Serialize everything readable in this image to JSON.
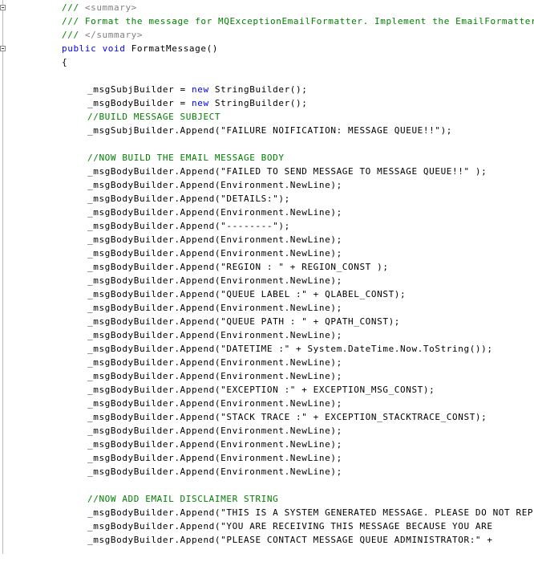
{
  "editor": {
    "lines": [
      {
        "indent": 1,
        "parts": [
          {
            "t": "/// ",
            "c": "cmt"
          },
          {
            "t": "<summary>",
            "c": "doc"
          }
        ]
      },
      {
        "indent": 1,
        "parts": [
          {
            "t": "/// Format the message for MQExceptionEmailFormatter. Implement the EmailFormatter",
            "c": "cmt"
          }
        ]
      },
      {
        "indent": 1,
        "parts": [
          {
            "t": "/// ",
            "c": "cmt"
          },
          {
            "t": "</summary>",
            "c": "doc"
          }
        ]
      },
      {
        "indent": 1,
        "parts": [
          {
            "t": "public",
            "c": "kw"
          },
          {
            "t": " ",
            "c": "plain"
          },
          {
            "t": "void",
            "c": "kw"
          },
          {
            "t": " FormatMessage()",
            "c": "plain"
          }
        ]
      },
      {
        "indent": 1,
        "parts": [
          {
            "t": "{",
            "c": "plain"
          }
        ]
      },
      {
        "indent": 2,
        "parts": []
      },
      {
        "indent": 2,
        "parts": [
          {
            "t": "_msgSubjBuilder = ",
            "c": "plain"
          },
          {
            "t": "new",
            "c": "kw"
          },
          {
            "t": " StringBuilder();",
            "c": "plain"
          }
        ]
      },
      {
        "indent": 2,
        "parts": [
          {
            "t": "_msgBodyBuilder = ",
            "c": "plain"
          },
          {
            "t": "new",
            "c": "kw"
          },
          {
            "t": " StringBuilder();",
            "c": "plain"
          }
        ]
      },
      {
        "indent": 2,
        "parts": [
          {
            "t": "//BUILD MESSAGE SUBJECT",
            "c": "cmt"
          }
        ]
      },
      {
        "indent": 2,
        "parts": [
          {
            "t": "_msgSubjBuilder.Append(\"FAILURE NOIFICATION: MESSAGE QUEUE!!\");",
            "c": "plain"
          }
        ]
      },
      {
        "indent": 2,
        "parts": []
      },
      {
        "indent": 2,
        "parts": [
          {
            "t": "//NOW BUILD THE EMAIL MESSAGE BODY",
            "c": "cmt"
          }
        ]
      },
      {
        "indent": 2,
        "parts": [
          {
            "t": "_msgBodyBuilder.Append(\"FAILED TO SEND MESSAGE TO MESSAGE QUEUE!!\" );",
            "c": "plain"
          }
        ]
      },
      {
        "indent": 2,
        "parts": [
          {
            "t": "_msgBodyBuilder.Append(Environment.NewLine);",
            "c": "plain"
          }
        ]
      },
      {
        "indent": 2,
        "parts": [
          {
            "t": "_msgBodyBuilder.Append(\"DETAILS:\");",
            "c": "plain"
          }
        ]
      },
      {
        "indent": 2,
        "parts": [
          {
            "t": "_msgBodyBuilder.Append(Environment.NewLine);",
            "c": "plain"
          }
        ]
      },
      {
        "indent": 2,
        "parts": [
          {
            "t": "_msgBodyBuilder.Append(\"--------\");",
            "c": "plain"
          }
        ]
      },
      {
        "indent": 2,
        "parts": [
          {
            "t": "_msgBodyBuilder.Append(Environment.NewLine);",
            "c": "plain"
          }
        ]
      },
      {
        "indent": 2,
        "parts": [
          {
            "t": "_msgBodyBuilder.Append(Environment.NewLine);",
            "c": "plain"
          }
        ]
      },
      {
        "indent": 2,
        "parts": [
          {
            "t": "_msgBodyBuilder.Append(\"REGION : \" + REGION_CONST );",
            "c": "plain"
          }
        ]
      },
      {
        "indent": 2,
        "parts": [
          {
            "t": "_msgBodyBuilder.Append(Environment.NewLine);",
            "c": "plain"
          }
        ]
      },
      {
        "indent": 2,
        "parts": [
          {
            "t": "_msgBodyBuilder.Append(\"QUEUE LABEL :\" + QLABEL_CONST);",
            "c": "plain"
          }
        ]
      },
      {
        "indent": 2,
        "parts": [
          {
            "t": "_msgBodyBuilder.Append(Environment.NewLine);",
            "c": "plain"
          }
        ]
      },
      {
        "indent": 2,
        "parts": [
          {
            "t": "_msgBodyBuilder.Append(\"QUEUE PATH : \" + QPATH_CONST);",
            "c": "plain"
          }
        ]
      },
      {
        "indent": 2,
        "parts": [
          {
            "t": "_msgBodyBuilder.Append(Environment.NewLine);",
            "c": "plain"
          }
        ]
      },
      {
        "indent": 2,
        "parts": [
          {
            "t": "_msgBodyBuilder.Append(\"DATETIME :\" + System.DateTime.Now.ToString());",
            "c": "plain"
          }
        ]
      },
      {
        "indent": 2,
        "parts": [
          {
            "t": "_msgBodyBuilder.Append(Environment.NewLine);",
            "c": "plain"
          }
        ]
      },
      {
        "indent": 2,
        "parts": [
          {
            "t": "_msgBodyBuilder.Append(Environment.NewLine);",
            "c": "plain"
          }
        ]
      },
      {
        "indent": 2,
        "parts": [
          {
            "t": "_msgBodyBuilder.Append(\"EXCEPTION :\" + EXCEPTION_MSG_CONST);",
            "c": "plain"
          }
        ]
      },
      {
        "indent": 2,
        "parts": [
          {
            "t": "_msgBodyBuilder.Append(Environment.NewLine);",
            "c": "plain"
          }
        ]
      },
      {
        "indent": 2,
        "parts": [
          {
            "t": "_msgBodyBuilder.Append(\"STACK TRACE :\" + EXCEPTION_STACKTRACE_CONST);",
            "c": "plain"
          }
        ]
      },
      {
        "indent": 2,
        "parts": [
          {
            "t": "_msgBodyBuilder.Append(Environment.NewLine);",
            "c": "plain"
          }
        ]
      },
      {
        "indent": 2,
        "parts": [
          {
            "t": "_msgBodyBuilder.Append(Environment.NewLine);",
            "c": "plain"
          }
        ]
      },
      {
        "indent": 2,
        "parts": [
          {
            "t": "_msgBodyBuilder.Append(Environment.NewLine);",
            "c": "plain"
          }
        ]
      },
      {
        "indent": 2,
        "parts": [
          {
            "t": "_msgBodyBuilder.Append(Environment.NewLine);",
            "c": "plain"
          }
        ]
      },
      {
        "indent": 2,
        "parts": []
      },
      {
        "indent": 2,
        "parts": [
          {
            "t": "//NOW ADD EMAIL DISCLAIMER STRING",
            "c": "cmt"
          }
        ]
      },
      {
        "indent": 2,
        "parts": [
          {
            "t": "_msgBodyBuilder.Append(\"THIS IS A SYSTEM GENERATED MESSAGE. PLEASE DO NOT REPLY",
            "c": "plain"
          }
        ]
      },
      {
        "indent": 2,
        "parts": [
          {
            "t": "_msgBodyBuilder.Append(\"YOU ARE RECEIVING THIS MESSAGE BECAUSE YOU ARE",
            "c": "plain"
          }
        ]
      },
      {
        "indent": 2,
        "parts": [
          {
            "t": "_msgBodyBuilder.Append(\"PLEASE CONTACT MESSAGE QUEUE ADMINISTRATOR:\" +",
            "c": "plain"
          }
        ]
      }
    ],
    "fold_markers": [
      0,
      3
    ],
    "colors": {
      "comment": "#008000",
      "doc_tag": "#808080",
      "keyword": "#0000ff",
      "text": "#000000"
    }
  }
}
